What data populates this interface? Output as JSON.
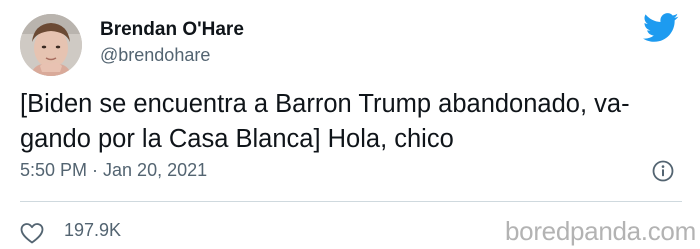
{
  "tweet": {
    "author_name": "Brendan O'Hare",
    "author_handle": "@brendohare",
    "text": "[Biden se encuentra a Barron Trump abandonado, va-\ngando por la Casa Blanca] Hola, chico",
    "timestamp": "5:50 PM · Jan 20, 2021",
    "likes": "197.9K"
  },
  "icons": {
    "brand": "twitter-bird-icon",
    "info": "info-icon",
    "like": "heart-icon"
  },
  "watermark": "boredpanda.com",
  "colors": {
    "twitter_blue": "#1d9bf0",
    "text_primary": "#0f1419",
    "text_secondary": "#536471",
    "divider": "#cfd9de",
    "watermark": "#b3b3b3"
  }
}
